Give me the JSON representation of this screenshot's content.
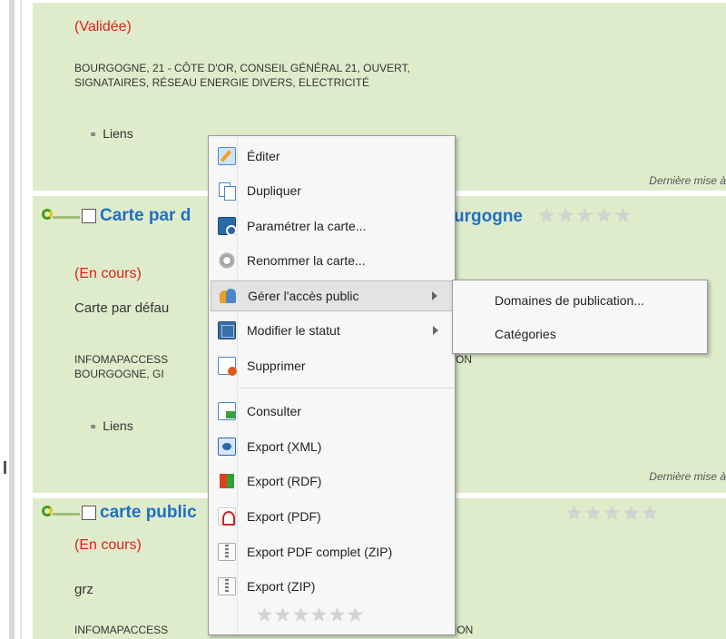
{
  "records": [
    {
      "status": "(Validée)",
      "keywords_line1": "BOURGOGNE, 21 - CÔTE D'OR, CONSEIL GÉNÉRAL 21, OUVERT,",
      "keywords_line2": "SIGNATAIRES, RÉSEAU ENERGIE DIVERS, ELECTRICITÉ",
      "links_label": "Liens",
      "last_update": "Dernière mise à"
    },
    {
      "title_left": "Carte par d",
      "title_right": "urgogne",
      "status": "(En cours)",
      "description": "Carte par défau",
      "keywords_line1": "INFOMAPACCESS",
      "keywords_line1_right": "ON",
      "keywords_line2": "BOURGOGNE, GI",
      "links_label": "Liens",
      "last_update": "Dernière mise à"
    },
    {
      "title_left": "carte public",
      "status": "(En cours)",
      "description": "grz",
      "keywords_line1": "INFOMAPACCESS",
      "keywords_line1_right": "ION"
    }
  ],
  "context_menu": {
    "items": [
      {
        "label": "Éditer",
        "icon": "edit-icon"
      },
      {
        "label": "Dupliquer",
        "icon": "duplicate-icon"
      },
      {
        "label": "Paramétrer la carte...",
        "icon": "map-settings-icon"
      },
      {
        "label": "Renommer la carte...",
        "icon": "gear-icon"
      },
      {
        "label": "Gérer l'accès public",
        "icon": "people-icon",
        "has_submenu": true,
        "highlighted": true
      },
      {
        "label": "Modifier le statut",
        "icon": "book-icon",
        "has_submenu": true
      },
      {
        "label": "Supprimer",
        "icon": "delete-icon"
      },
      {
        "label": "Consulter",
        "icon": "view-icon"
      },
      {
        "label": "Export (XML)",
        "icon": "xml-icon"
      },
      {
        "label": "Export (RDF)",
        "icon": "rdf-icon"
      },
      {
        "label": "Export (PDF)",
        "icon": "pdf-icon"
      },
      {
        "label": "Export PDF complet (ZIP)",
        "icon": "zip-icon"
      },
      {
        "label": "Export (ZIP)",
        "icon": "zip-icon"
      }
    ]
  },
  "submenu": {
    "items": [
      {
        "label": "Domaines de publication..."
      },
      {
        "label": "Catégories"
      }
    ]
  },
  "colors": {
    "record_bg": "#dfeccb",
    "status_red": "#e0201a",
    "title_blue": "#1f6fc5"
  }
}
